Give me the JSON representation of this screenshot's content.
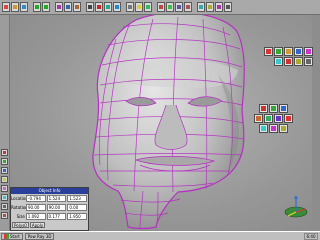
{
  "panel": {
    "title": "Object Info",
    "rows": [
      {
        "label": "Location",
        "values": [
          "-0.794",
          "1.524",
          "1.523"
        ]
      },
      {
        "label": "Rotation",
        "values": [
          "90.00",
          "90.00",
          "0.00"
        ]
      },
      {
        "label": "Size",
        "values": [
          "1.092",
          "0.177",
          "1.950"
        ]
      }
    ],
    "unit_value": "Polys0",
    "apply_label": "Apply"
  },
  "taskbar": {
    "start_label": "Start",
    "app_label": "Pow Ray 3D",
    "tray_text": "6:40"
  },
  "colors": {
    "wireframe": "#b62fc4",
    "mesh_fill": "#c3c3c3",
    "panel_title": "#2a3f9c"
  },
  "icons": {
    "topbar": [
      "file-icon",
      "open-icon",
      "save-icon",
      "undo-icon",
      "redo-icon",
      "cut-icon",
      "copy-icon",
      "paste-icon",
      "select-icon",
      "move-icon",
      "rotate-icon",
      "scale-icon",
      "camera-icon",
      "light-icon",
      "render-icon"
    ]
  }
}
